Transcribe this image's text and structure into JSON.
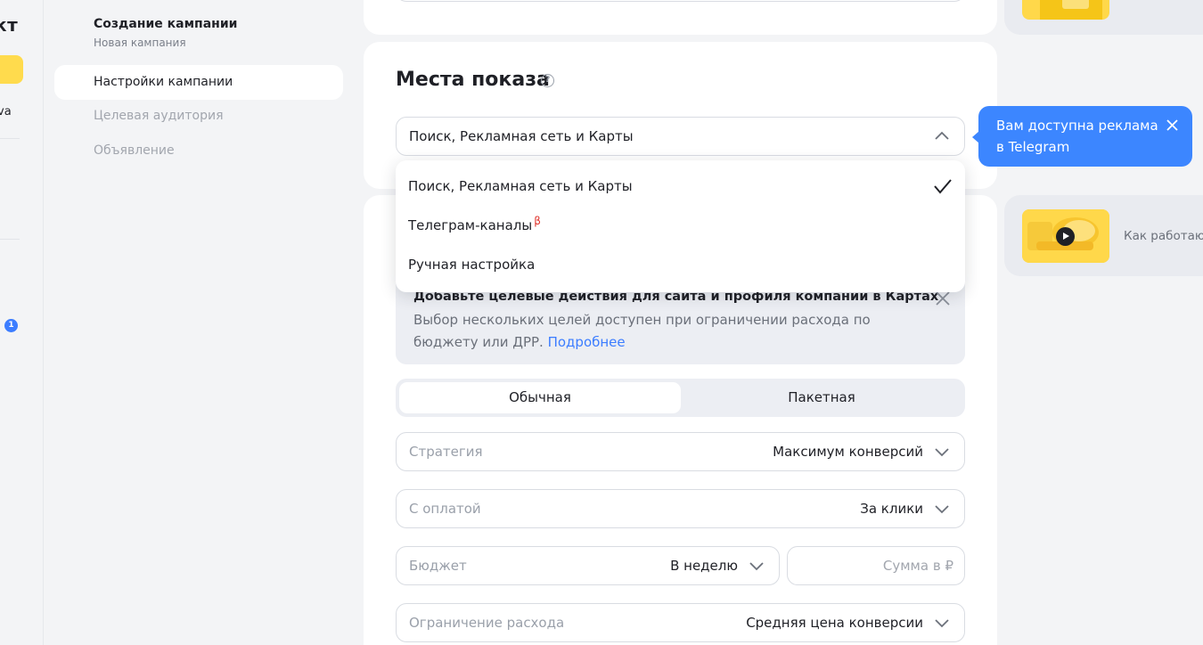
{
  "nav": {
    "logo_text": "кт",
    "user_text": "va",
    "badge_count": "1"
  },
  "steps": {
    "title": "Создание кампании",
    "subtitle": "Новая кампания",
    "items": [
      {
        "label": "Настройки кампании",
        "active": true
      },
      {
        "label": "Целевая аудитория",
        "active": false
      },
      {
        "label": "Объявление",
        "active": false
      }
    ]
  },
  "places": {
    "heading": "Места показа",
    "help_icon": "?",
    "selected": "Поиск, Рекламная сеть и Карты"
  },
  "dropdown": {
    "options": [
      {
        "label": "Поиск, Рекламная сеть и Карты",
        "checked": true
      },
      {
        "label": "Телеграм-каналы",
        "beta": "β"
      },
      {
        "label": "Ручная настройка"
      }
    ]
  },
  "banner": {
    "title": "Добавьте целевые действия для сайта и профиля компании в Картах",
    "text": "Выбор нескольких целей доступен при ограничении расхода по бюджету или ДРР.",
    "link": "Подробнее"
  },
  "strategy_tabs": {
    "options": [
      "Обычная",
      "Пакетная"
    ],
    "selected": "Обычная"
  },
  "form": {
    "strategy": {
      "label": "Стратегия",
      "value": "Максимум конверсий"
    },
    "payment": {
      "label": "С оплатой",
      "value": "За клики"
    },
    "budget": {
      "label": "Бюджет",
      "value": "В неделю"
    },
    "amount_placeholder": "Сумма в ₽",
    "limit": {
      "label": "Ограничение расхода",
      "value": "Средняя цена конверсии"
    }
  },
  "right_column": {
    "how_it_works": "Как работают"
  },
  "tooltip": {
    "text": "Вам доступна реклама в Telegram"
  },
  "colors": {
    "accent_yellow": "#ffdb4d",
    "tooltip_blue": "#3c86ff",
    "link_blue": "#3c7dff",
    "beta_red": "#e0332c"
  }
}
